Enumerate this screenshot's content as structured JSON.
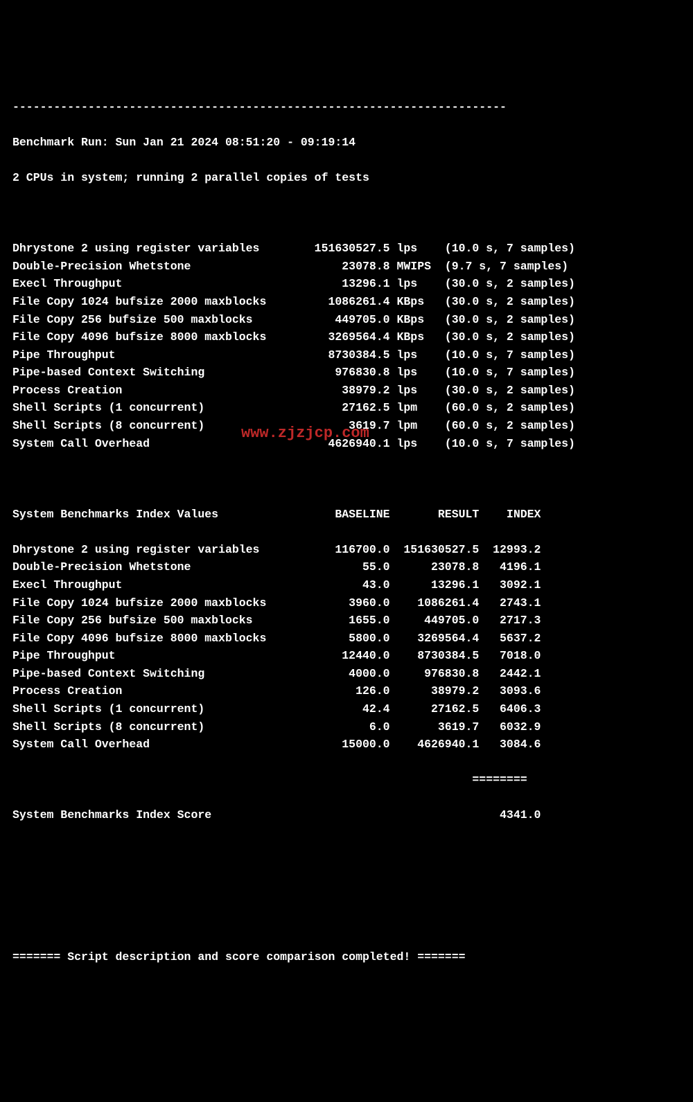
{
  "dashes": "------------------------------------------------------------------------",
  "header": {
    "run_line": "Benchmark Run: Sun Jan 21 2024 08:51:20 - 09:19:14",
    "cpu_line": "2 CPUs in system; running 2 parallel copies of tests"
  },
  "results": [
    {
      "name": "Dhrystone 2 using register variables",
      "value": "151630527.5",
      "unit": "lps",
      "params": "(10.0 s, 7 samples)"
    },
    {
      "name": "Double-Precision Whetstone",
      "value": "23078.8",
      "unit": "MWIPS",
      "params": "(9.7 s, 7 samples)"
    },
    {
      "name": "Execl Throughput",
      "value": "13296.1",
      "unit": "lps",
      "params": "(30.0 s, 2 samples)"
    },
    {
      "name": "File Copy 1024 bufsize 2000 maxblocks",
      "value": "1086261.4",
      "unit": "KBps",
      "params": "(30.0 s, 2 samples)"
    },
    {
      "name": "File Copy 256 bufsize 500 maxblocks",
      "value": "449705.0",
      "unit": "KBps",
      "params": "(30.0 s, 2 samples)"
    },
    {
      "name": "File Copy 4096 bufsize 8000 maxblocks",
      "value": "3269564.4",
      "unit": "KBps",
      "params": "(30.0 s, 2 samples)"
    },
    {
      "name": "Pipe Throughput",
      "value": "8730384.5",
      "unit": "lps",
      "params": "(10.0 s, 7 samples)"
    },
    {
      "name": "Pipe-based Context Switching",
      "value": "976830.8",
      "unit": "lps",
      "params": "(10.0 s, 7 samples)"
    },
    {
      "name": "Process Creation",
      "value": "38979.2",
      "unit": "lps",
      "params": "(30.0 s, 2 samples)"
    },
    {
      "name": "Shell Scripts (1 concurrent)",
      "value": "27162.5",
      "unit": "lpm",
      "params": "(60.0 s, 2 samples)"
    },
    {
      "name": "Shell Scripts (8 concurrent)",
      "value": "3619.7",
      "unit": "lpm",
      "params": "(60.0 s, 2 samples)"
    },
    {
      "name": "System Call Overhead",
      "value": "4626940.1",
      "unit": "lps",
      "params": "(10.0 s, 7 samples)"
    }
  ],
  "index_header": {
    "title": "System Benchmarks Index Values",
    "col_baseline": "BASELINE",
    "col_result": "RESULT",
    "col_index": "INDEX"
  },
  "index_rows": [
    {
      "name": "Dhrystone 2 using register variables",
      "baseline": "116700.0",
      "result": "151630527.5",
      "index": "12993.2"
    },
    {
      "name": "Double-Precision Whetstone",
      "baseline": "55.0",
      "result": "23078.8",
      "index": "4196.1"
    },
    {
      "name": "Execl Throughput",
      "baseline": "43.0",
      "result": "13296.1",
      "index": "3092.1"
    },
    {
      "name": "File Copy 1024 bufsize 2000 maxblocks",
      "baseline": "3960.0",
      "result": "1086261.4",
      "index": "2743.1"
    },
    {
      "name": "File Copy 256 bufsize 500 maxblocks",
      "baseline": "1655.0",
      "result": "449705.0",
      "index": "2717.3"
    },
    {
      "name": "File Copy 4096 bufsize 8000 maxblocks",
      "baseline": "5800.0",
      "result": "3269564.4",
      "index": "5637.2"
    },
    {
      "name": "Pipe Throughput",
      "baseline": "12440.0",
      "result": "8730384.5",
      "index": "7018.0"
    },
    {
      "name": "Pipe-based Context Switching",
      "baseline": "4000.0",
      "result": "976830.8",
      "index": "2442.1"
    },
    {
      "name": "Process Creation",
      "baseline": "126.0",
      "result": "38979.2",
      "index": "3093.6"
    },
    {
      "name": "Shell Scripts (1 concurrent)",
      "baseline": "42.4",
      "result": "27162.5",
      "index": "6406.3"
    },
    {
      "name": "Shell Scripts (8 concurrent)",
      "baseline": "6.0",
      "result": "3619.7",
      "index": "6032.9"
    },
    {
      "name": "System Call Overhead",
      "baseline": "15000.0",
      "result": "4626940.1",
      "index": "3084.6"
    }
  ],
  "score_rule": "                                                                   ========",
  "score_line": {
    "label": "System Benchmarks Index Score",
    "value": "4341.0"
  },
  "footer": "======= Script description and score comparison completed! =======",
  "watermark": "www.zjzjcp.com"
}
